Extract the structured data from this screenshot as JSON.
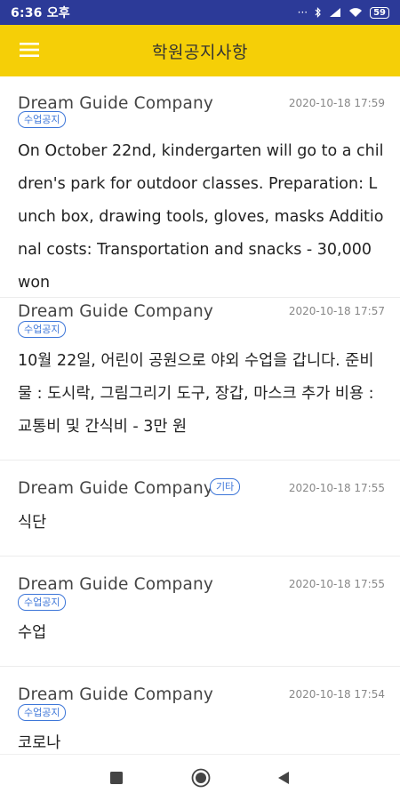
{
  "status_bar": {
    "time": "6:36 오후",
    "icons": [
      "dots-icon",
      "bluetooth-icon",
      "signal-icon",
      "wifi-icon",
      "battery-icon"
    ],
    "dots": "···",
    "battery": "59"
  },
  "app_bar": {
    "title": "학원공지사항",
    "menu_icon": "hamburger-menu-icon",
    "color": "#f5cf07"
  },
  "notices": [
    {
      "sender": "Dream Guide Company",
      "datetime": "2020-10-18 17:59",
      "tag": "수업공지",
      "body": "On October 22nd, kindergarten will go to a children's park for outdoor classes. Preparation: Lunch box, drawing tools, gloves, masks Additional costs: Transportation and snacks - 30,000 won"
    },
    {
      "sender": "Dream Guide Company",
      "datetime": "2020-10-18 17:57",
      "tag": "수업공지",
      "body": "10월 22일, 어린이 공원으로 야외 수업을 갑니다. 준비물 : 도시락, 그림그리기 도구, 장갑, 마스크 추가 비용 : 교통비 및 간식비 - 3만 원"
    },
    {
      "sender": "Dream Guide Company",
      "datetime": "2020-10-18 17:55",
      "tag": "기타",
      "body": "식단"
    },
    {
      "sender": "Dream Guide Company",
      "datetime": "2020-10-18 17:55",
      "tag": "수업공지",
      "body": "수업"
    },
    {
      "sender": "Dream Guide Company",
      "datetime": "2020-10-18 17:54",
      "tag": "수업공지",
      "body": "코로나"
    }
  ],
  "nav_bar": {
    "buttons": [
      "recent-apps-icon",
      "home-icon",
      "back-icon"
    ]
  }
}
